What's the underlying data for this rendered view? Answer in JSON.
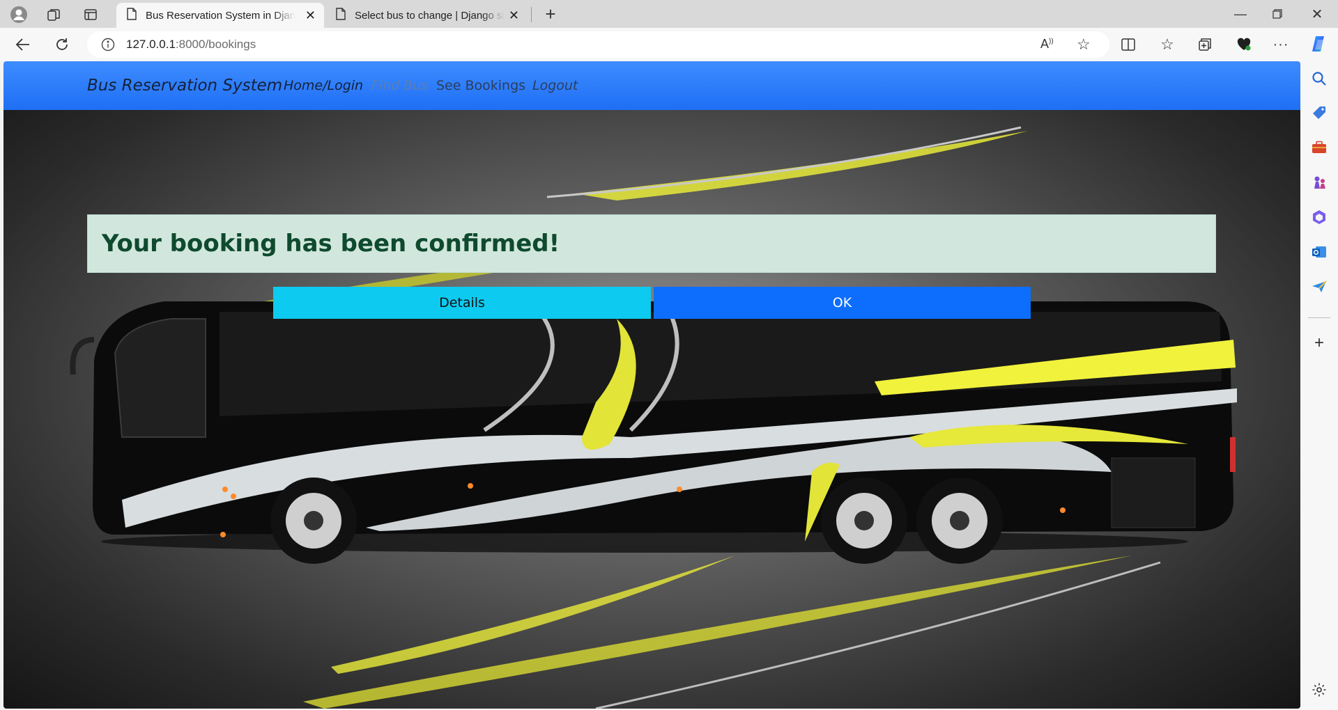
{
  "browser": {
    "tabs": [
      {
        "title": "Bus Reservation System in Django",
        "active": true
      },
      {
        "title": "Select bus to change | Django site admin",
        "active": false
      }
    ],
    "address": {
      "host": "127.0.0.1",
      "path": ":8000/bookings"
    },
    "colors": {
      "tabbar": "#d9d9d9",
      "toolbar": "#f7f7f7"
    }
  },
  "navbar": {
    "brand": "Bus Reservation System",
    "links": [
      {
        "label": "Home/Login",
        "color": "#14213a"
      },
      {
        "label": "Find Bus",
        "color": "#5a7fb5"
      },
      {
        "label": "See Bookings",
        "color": "#2c3d5c"
      },
      {
        "label": "Logout",
        "color": "#2c3d5c"
      }
    ],
    "color": "#2479ff"
  },
  "alert": {
    "message": "Your booking has been confirmed!",
    "background": "#d1e7dd",
    "text_color": "#0f4a2e"
  },
  "buttons": {
    "details": "Details",
    "ok": "OK"
  },
  "hero": {
    "image": "black bus with yellow and silver swoosh livery on grey studio background"
  }
}
